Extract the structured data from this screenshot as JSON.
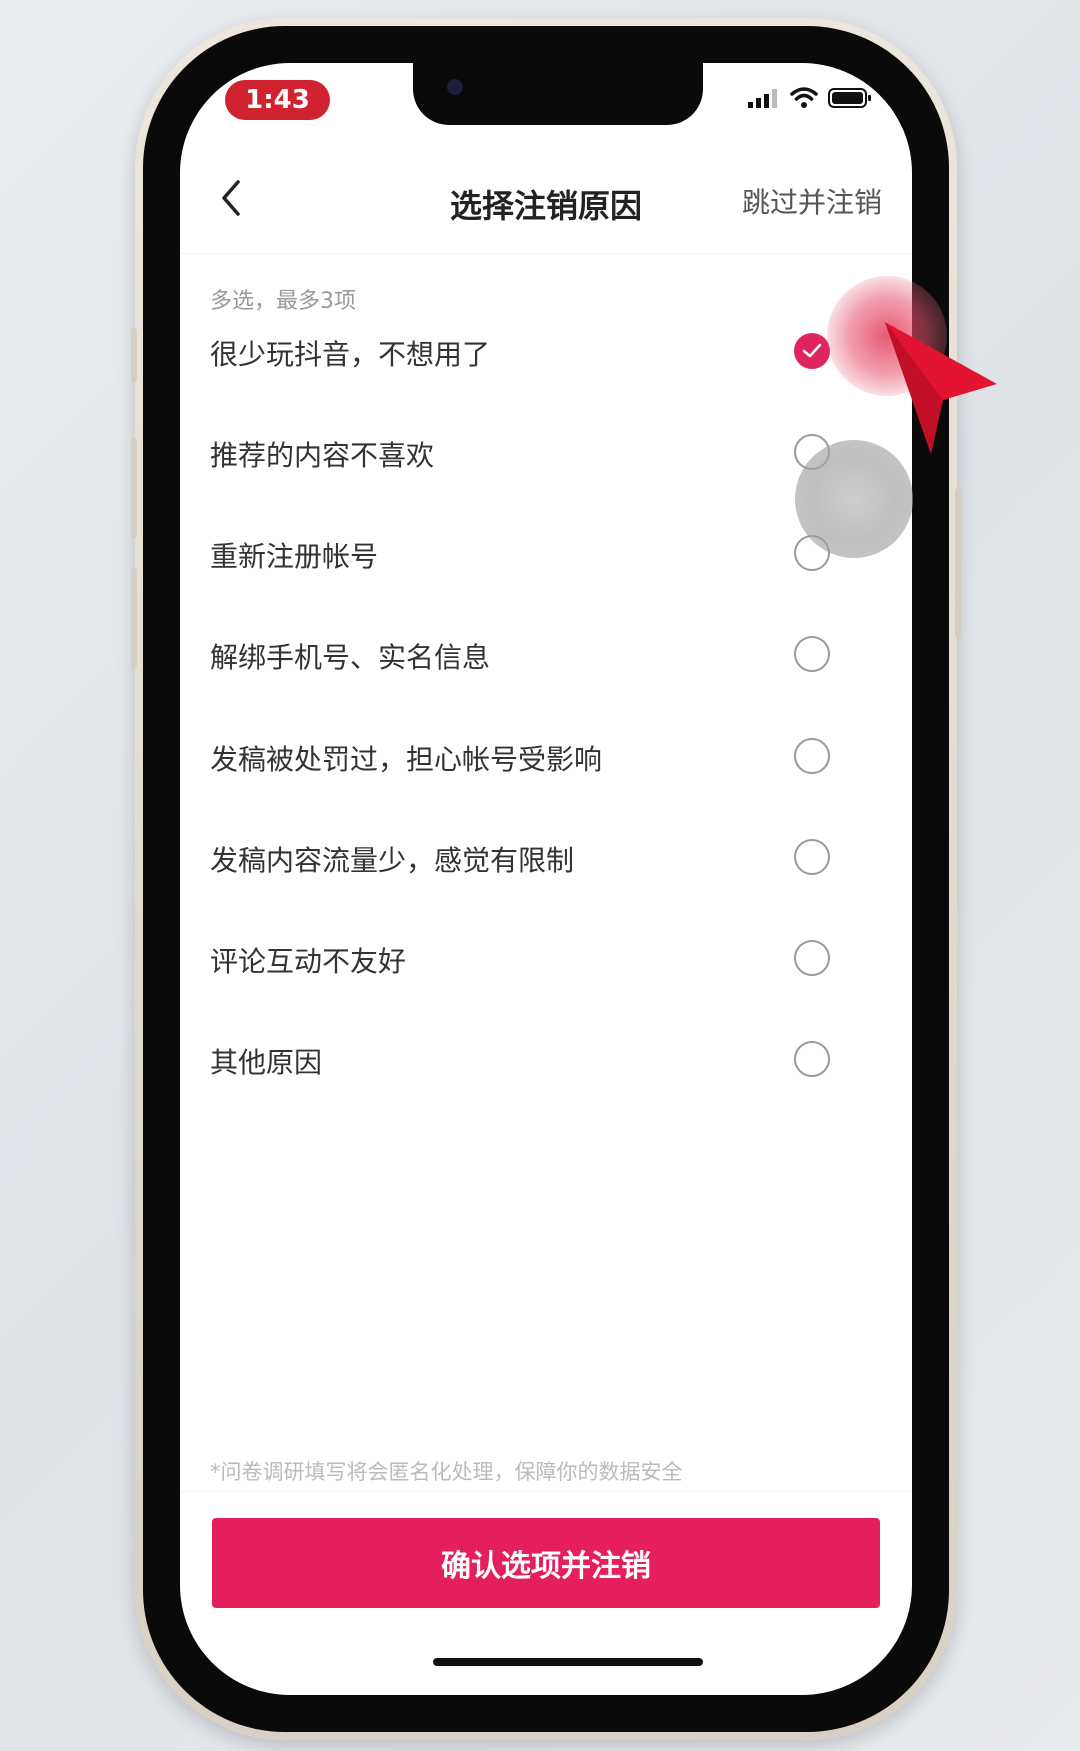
{
  "status_bar": {
    "time": "1:43"
  },
  "header": {
    "title": "选择注销原因",
    "skip_label": "跳过并注销"
  },
  "hint": "多选，最多3项",
  "options": [
    {
      "label": "很少玩抖音，不想用了",
      "checked": true
    },
    {
      "label": "推荐的内容不喜欢",
      "checked": false
    },
    {
      "label": "重新注册帐号",
      "checked": false
    },
    {
      "label": "解绑手机号、实名信息",
      "checked": false
    },
    {
      "label": "发稿被处罚过，担心帐号受影响",
      "checked": false
    },
    {
      "label": "发稿内容流量少，感觉有限制",
      "checked": false
    },
    {
      "label": "评论互动不友好",
      "checked": false
    },
    {
      "label": "其他原因",
      "checked": false
    }
  ],
  "footnote": "*问卷调研填写将会匿名化处理，保障你的数据安全",
  "confirm_label": "确认选项并注销",
  "colors": {
    "accent": "#e51e5c",
    "time_pill": "#d0222f"
  }
}
